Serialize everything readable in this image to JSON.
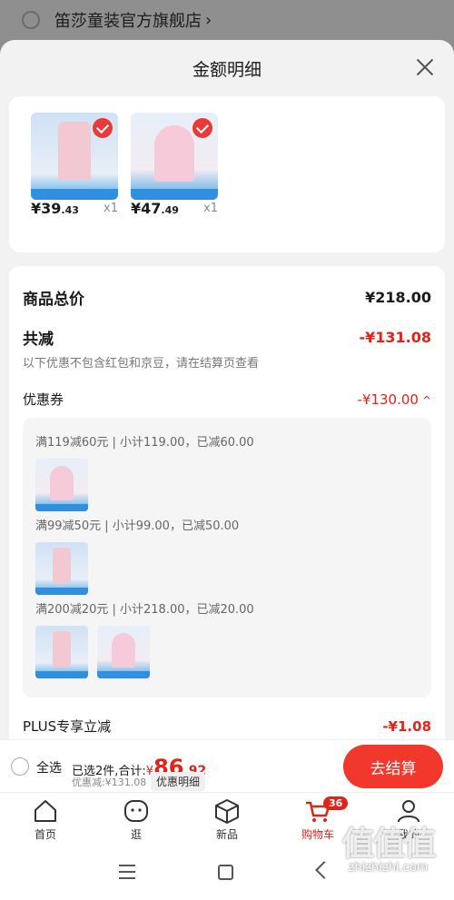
{
  "store": {
    "name": "笛莎童装官方旗舰店",
    "chevron": "›"
  },
  "sheet": {
    "title": "金额明细"
  },
  "products": [
    {
      "price_int": "¥39",
      "price_dec": ".43",
      "qty": "x1"
    },
    {
      "price_int": "¥47",
      "price_dec": ".49",
      "qty": "x1"
    }
  ],
  "detail": {
    "total_label": "商品总价",
    "total_value": "¥218.00",
    "reduce_label": "共减",
    "reduce_value": "-¥131.08",
    "note": "以下优惠不包含红包和京豆，请在结算页查看",
    "coupon_label": "优惠券",
    "coupon_value": "-¥130.00",
    "coupon_caret": "^",
    "coupons": [
      "满119减60元 | 小计119.00，已减60.00",
      "满99减50元 | 小计99.00，已减50.00",
      "满200减20元 | 小计218.00，已减20.00"
    ],
    "plus_label": "PLUS专享立减",
    "plus_value": "-¥1.08"
  },
  "action_bar": {
    "select_all": "全选",
    "summary_prefix": "已选2件,合计:",
    "currency": "¥",
    "total_int": "86",
    "total_dec": ".92",
    "discount": "优惠减:¥131.08",
    "detail_chip": "优惠明细",
    "checkout": "去结算"
  },
  "tabs": [
    {
      "label": "首页",
      "icon": "home-icon",
      "active": false
    },
    {
      "label": "逛",
      "icon": "face-icon",
      "active": false
    },
    {
      "label": "新品",
      "icon": "cube-icon",
      "active": false
    },
    {
      "label": "购物车",
      "icon": "cart-icon",
      "active": true,
      "badge": "36"
    },
    {
      "label": "我的",
      "icon": "profile-icon",
      "active": false
    }
  ],
  "watermark": {
    "glyphs": "值值值",
    "url": "zhizhizhi.com"
  },
  "colors": {
    "accent_red": "#e2231a",
    "checkout_red": "#f2372c",
    "sheet_bg": "#f2f2f2"
  }
}
